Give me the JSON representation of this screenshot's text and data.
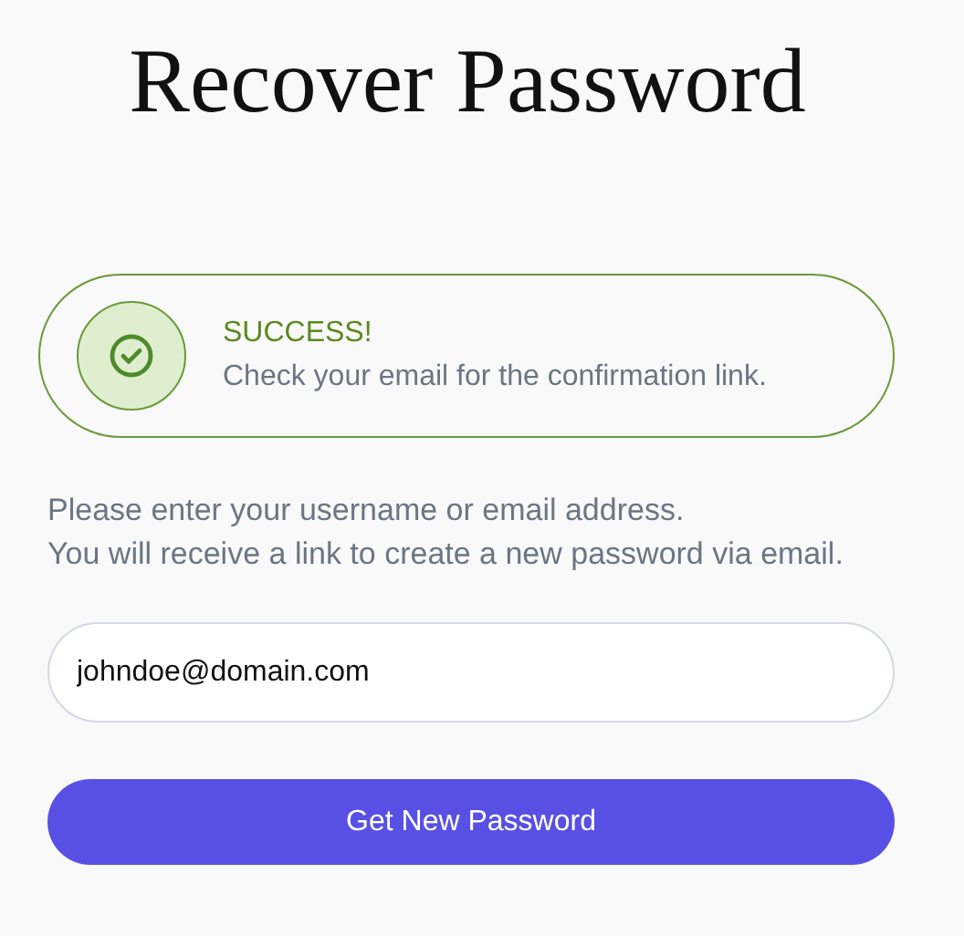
{
  "title": "Recover Password",
  "alert": {
    "kind": "success",
    "heading": "SUCCESS!",
    "message": "Check your email for the confirmation link."
  },
  "instructions": [
    "Please enter your username or email address.",
    "You will receive a link to create a new password via email."
  ],
  "email_field": {
    "value": "johndoe@domain.com"
  },
  "submit_button": {
    "label": "Get New Password"
  }
}
